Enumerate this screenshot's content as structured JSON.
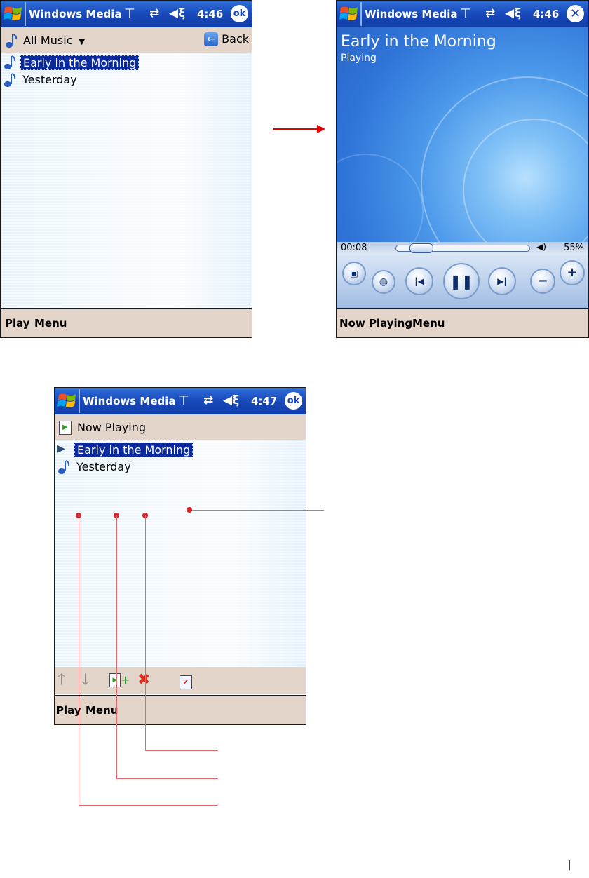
{
  "screen1": {
    "title": "Windows Media",
    "time": "4:46",
    "ok_label": "ok",
    "subbar_label": "All Music",
    "back_label": "Back",
    "items": [
      {
        "label": "Early in the Morning",
        "selected": true
      },
      {
        "label": "Yesterday",
        "selected": false
      }
    ],
    "menu_left": "Play",
    "menu_right": "Menu"
  },
  "screen2": {
    "title": "Windows Media",
    "time": "4:46",
    "song_title": "Early in the Morning",
    "status": "Playing",
    "elapsed": "00:08",
    "volume": "55%",
    "progress": 0.12,
    "menu_left": "Now Playing",
    "menu_right": "Menu"
  },
  "screen3": {
    "title": "Windows Media",
    "time": "4:47",
    "ok_label": "ok",
    "subbar_label": "Now Playing",
    "items": [
      {
        "label": "Early in the Morning",
        "selected": true,
        "playing": true
      },
      {
        "label": "Yesterday",
        "selected": false,
        "playing": false
      }
    ],
    "menu_left": "Play",
    "menu_right": "Menu"
  },
  "page_marker": "|",
  "colors": {
    "titlebar": "#1746b8",
    "menubar": "#e3d5c9",
    "selection": "#0b2a9e",
    "arrow": "#e00000",
    "callout": "#e06a6a"
  },
  "icons": [
    "windows-flag-icon",
    "signal-icon",
    "sync-icon",
    "speaker-icon",
    "ok-icon",
    "close-icon",
    "music-note-icon",
    "dropdown-arrow-icon",
    "back-arrow-icon",
    "now-playing-icon",
    "play-indicator-icon",
    "move-up-icon",
    "move-down-icon",
    "add-to-playlist-icon",
    "delete-icon",
    "playlist-properties-icon"
  ]
}
